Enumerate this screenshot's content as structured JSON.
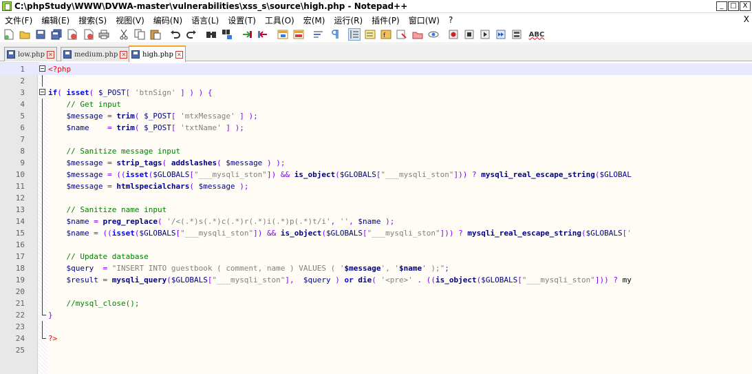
{
  "window": {
    "title": "C:\\phpStudy\\WWW\\DVWA-master\\vulnerabilities\\xss_s\\source\\high.php - Notepad++",
    "controls": [
      "_",
      "□",
      "X"
    ]
  },
  "menu": {
    "items": [
      "文件(F)",
      "编辑(E)",
      "搜索(S)",
      "视图(V)",
      "编码(N)",
      "语言(L)",
      "设置(T)",
      "工具(O)",
      "宏(M)",
      "运行(R)",
      "插件(P)",
      "窗口(W)",
      "?"
    ],
    "close_label": "X"
  },
  "toolbar": {
    "icons": [
      "new-file-icon",
      "open-file-icon",
      "save-icon",
      "save-all-icon",
      "close-icon",
      "close-all-icon",
      "print-icon",
      "cut-icon",
      "copy-icon",
      "paste-icon",
      "undo-icon",
      "redo-icon",
      "find-icon",
      "replace-icon",
      "zoom-in-icon",
      "zoom-out-icon",
      "sync-vertical-icon",
      "sync-horizontal-icon",
      "word-wrap-icon",
      "show-all-chars-icon",
      "indent-guide-icon",
      "doc-map-icon",
      "function-list-icon",
      "folder-workspace-icon",
      "monitor-icon",
      "eye-icon",
      "record-macro-icon",
      "stop-macro-icon",
      "play-macro-icon",
      "run-macro-multiple-icon",
      "save-macro-icon",
      "spell-check-icon"
    ],
    "spell_label": "ABC"
  },
  "tabs": [
    {
      "label": "low.php",
      "active": false
    },
    {
      "label": "medium.php",
      "active": false
    },
    {
      "label": "high.php",
      "active": true
    }
  ],
  "editor": {
    "current_line": 1,
    "lines": [
      {
        "n": "1",
        "fold": "box",
        "code": "<?php"
      },
      {
        "n": "2",
        "fold": "vline",
        "code": ""
      },
      {
        "n": "3",
        "fold": "box",
        "code": "if( isset( $_POST[ 'btnSign' ] ) ) {"
      },
      {
        "n": "4",
        "fold": "vline",
        "code": "    // Get input"
      },
      {
        "n": "5",
        "fold": "vline",
        "code": "    $message = trim( $_POST[ 'mtxMessage' ] );"
      },
      {
        "n": "6",
        "fold": "vline",
        "code": "    $name    = trim( $_POST[ 'txtName' ] );"
      },
      {
        "n": "7",
        "fold": "vline",
        "code": ""
      },
      {
        "n": "8",
        "fold": "vline",
        "code": "    // Sanitize message input"
      },
      {
        "n": "9",
        "fold": "vline",
        "code": "    $message = strip_tags( addslashes( $message ) );"
      },
      {
        "n": "10",
        "fold": "vline",
        "code": "    $message = ((isset($GLOBALS[\"___mysqli_ston\"]) && is_object($GLOBALS[\"___mysqli_ston\"])) ? mysqli_real_escape_string($GLOBAL"
      },
      {
        "n": "11",
        "fold": "vline",
        "code": "    $message = htmlspecialchars( $message );"
      },
      {
        "n": "12",
        "fold": "vline",
        "code": ""
      },
      {
        "n": "13",
        "fold": "vline",
        "code": "    // Sanitize name input"
      },
      {
        "n": "14",
        "fold": "vline",
        "code": "    $name = preg_replace( '/<(.*)s(.*)c(.*)r(.*)i(.*)p(.*)t/i', '', $name );"
      },
      {
        "n": "15",
        "fold": "vline",
        "code": "    $name = ((isset($GLOBALS[\"___mysqli_ston\"]) && is_object($GLOBALS[\"___mysqli_ston\"])) ? mysqli_real_escape_string($GLOBALS['"
      },
      {
        "n": "16",
        "fold": "vline",
        "code": ""
      },
      {
        "n": "17",
        "fold": "vline",
        "code": "    // Update database"
      },
      {
        "n": "18",
        "fold": "vline",
        "code": "    $query  = \"INSERT INTO guestbook ( comment, name ) VALUES ( '$message', '$name' );\";"
      },
      {
        "n": "19",
        "fold": "vline",
        "code": "    $result = mysqli_query($GLOBALS[\"___mysqli_ston\"],  $query ) or die( '<pre>' . ((is_object($GLOBALS[\"___mysqli_ston\"])) ? my"
      },
      {
        "n": "20",
        "fold": "vline",
        "code": ""
      },
      {
        "n": "21",
        "fold": "vline",
        "code": "    //mysql_close();"
      },
      {
        "n": "22",
        "fold": "end",
        "code": "}"
      },
      {
        "n": "23",
        "fold": "vline",
        "code": ""
      },
      {
        "n": "24",
        "fold": "end",
        "code": "?>"
      },
      {
        "n": "25",
        "fold": "none",
        "code": ""
      }
    ]
  },
  "colors": {
    "keyword": "#0000ff",
    "function": "#000080",
    "string": "#808080",
    "comment": "#008000",
    "php_tag": "#ff0000",
    "operator": "#8000ff",
    "current_line_bg": "#e8e8ff",
    "fold_marker": "#cc0000"
  }
}
